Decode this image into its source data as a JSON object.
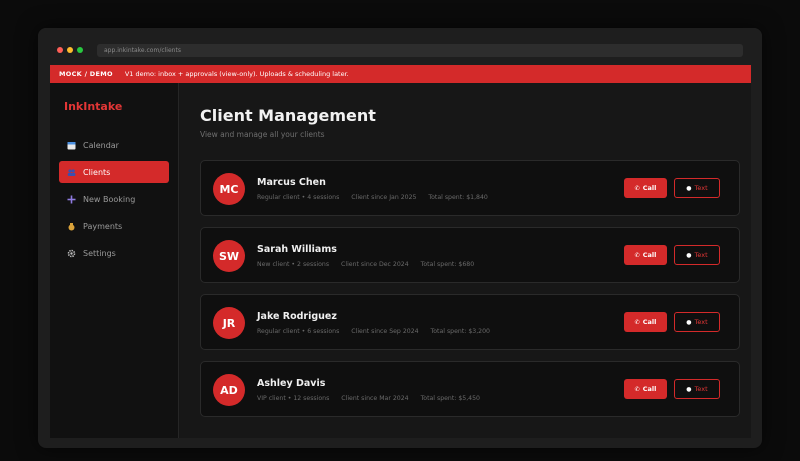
{
  "browser": {
    "url": "app.inkintake.com/clients"
  },
  "banner": {
    "tag": "MOCK / DEMO",
    "message": "V1 demo: inbox + approvals (view-only). Uploads & scheduling later."
  },
  "sidebar": {
    "brand": "InkIntake",
    "items": [
      {
        "label": "Calendar",
        "icon": "calendar-icon"
      },
      {
        "label": "Clients",
        "icon": "clients-icon",
        "active": true
      },
      {
        "label": "New Booking",
        "icon": "plus-icon"
      },
      {
        "label": "Payments",
        "icon": "money-bag-icon"
      },
      {
        "label": "Settings",
        "icon": "gear-icon"
      }
    ]
  },
  "main": {
    "title": "Client Management",
    "subtitle": "View and manage all your clients"
  },
  "clients": [
    {
      "initials": "MC",
      "name": "Marcus Chen",
      "type": "Regular client • 4 sessions",
      "since": "Client since Jan 2025",
      "spent": "Total spent: $1,840"
    },
    {
      "initials": "SW",
      "name": "Sarah Williams",
      "type": "New client • 2 sessions",
      "since": "Client since Dec 2024",
      "spent": "Total spent: $680"
    },
    {
      "initials": "JR",
      "name": "Jake Rodriguez",
      "type": "Regular client • 6 sessions",
      "since": "Client since Sep 2024",
      "spent": "Total spent: $3,200"
    },
    {
      "initials": "AD",
      "name": "Ashley Davis",
      "type": "VIP client • 12 sessions",
      "since": "Client since Mar 2024",
      "spent": "Total spent: $5,450"
    }
  ],
  "actions": {
    "call_label": "Call",
    "text_label": "Text"
  },
  "colors": {
    "accent": "#d42a2a",
    "background": "#171717",
    "card": "#0f0f0f"
  }
}
